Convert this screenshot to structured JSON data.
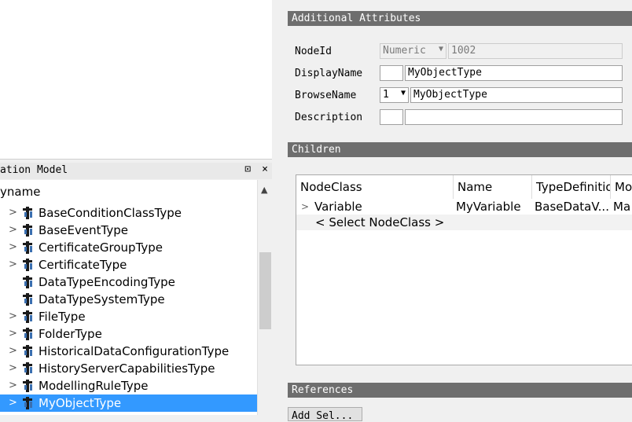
{
  "left": {
    "panel_title": "ation Model",
    "pin_label": "⊡",
    "close_label": "×",
    "tree_column": "yname",
    "tree_items": [
      {
        "label": "BaseConditionClassType",
        "expandable": true
      },
      {
        "label": "BaseEventType",
        "expandable": true
      },
      {
        "label": "CertificateGroupType",
        "expandable": true
      },
      {
        "label": "CertificateType",
        "expandable": true
      },
      {
        "label": "DataTypeEncodingType",
        "expandable": false
      },
      {
        "label": "DataTypeSystemType",
        "expandable": false
      },
      {
        "label": "FileType",
        "expandable": true
      },
      {
        "label": "FolderType",
        "expandable": true
      },
      {
        "label": "HistoricalDataConfigurationType",
        "expandable": true
      },
      {
        "label": "HistoryServerCapabilitiesType",
        "expandable": true
      },
      {
        "label": "ModellingRuleType",
        "expandable": true
      },
      {
        "label": "MyObjectType",
        "expandable": true,
        "selected": true
      }
    ]
  },
  "attributes": {
    "header": "Additional Attributes",
    "nodeid_label": "NodeId",
    "nodeid_type": "Numeric",
    "nodeid_value": "1002",
    "displayname_label": "DisplayName",
    "displayname_locale": "",
    "displayname_value": "MyObjectType",
    "browsename_label": "BrowseName",
    "browsename_ns": "1",
    "browsename_value": "MyObjectType",
    "description_label": "Description",
    "description_locale": "",
    "description_value": ""
  },
  "children": {
    "header": "Children",
    "columns": [
      "NodeClass",
      "Name",
      "TypeDefinitio",
      "Mo"
    ],
    "rows": [
      {
        "nodeclass": "Variable",
        "name": "MyVariable",
        "typedef": "BaseDataV...",
        "modelling": "Ma"
      }
    ],
    "add_row_label": "< Select NodeClass >"
  },
  "references": {
    "header": "References",
    "button_label": "Add Sel..."
  },
  "colors": {
    "selection": "#3399ff",
    "section_header": "#6e6e6e",
    "panel_bg": "#f0f0f0"
  }
}
